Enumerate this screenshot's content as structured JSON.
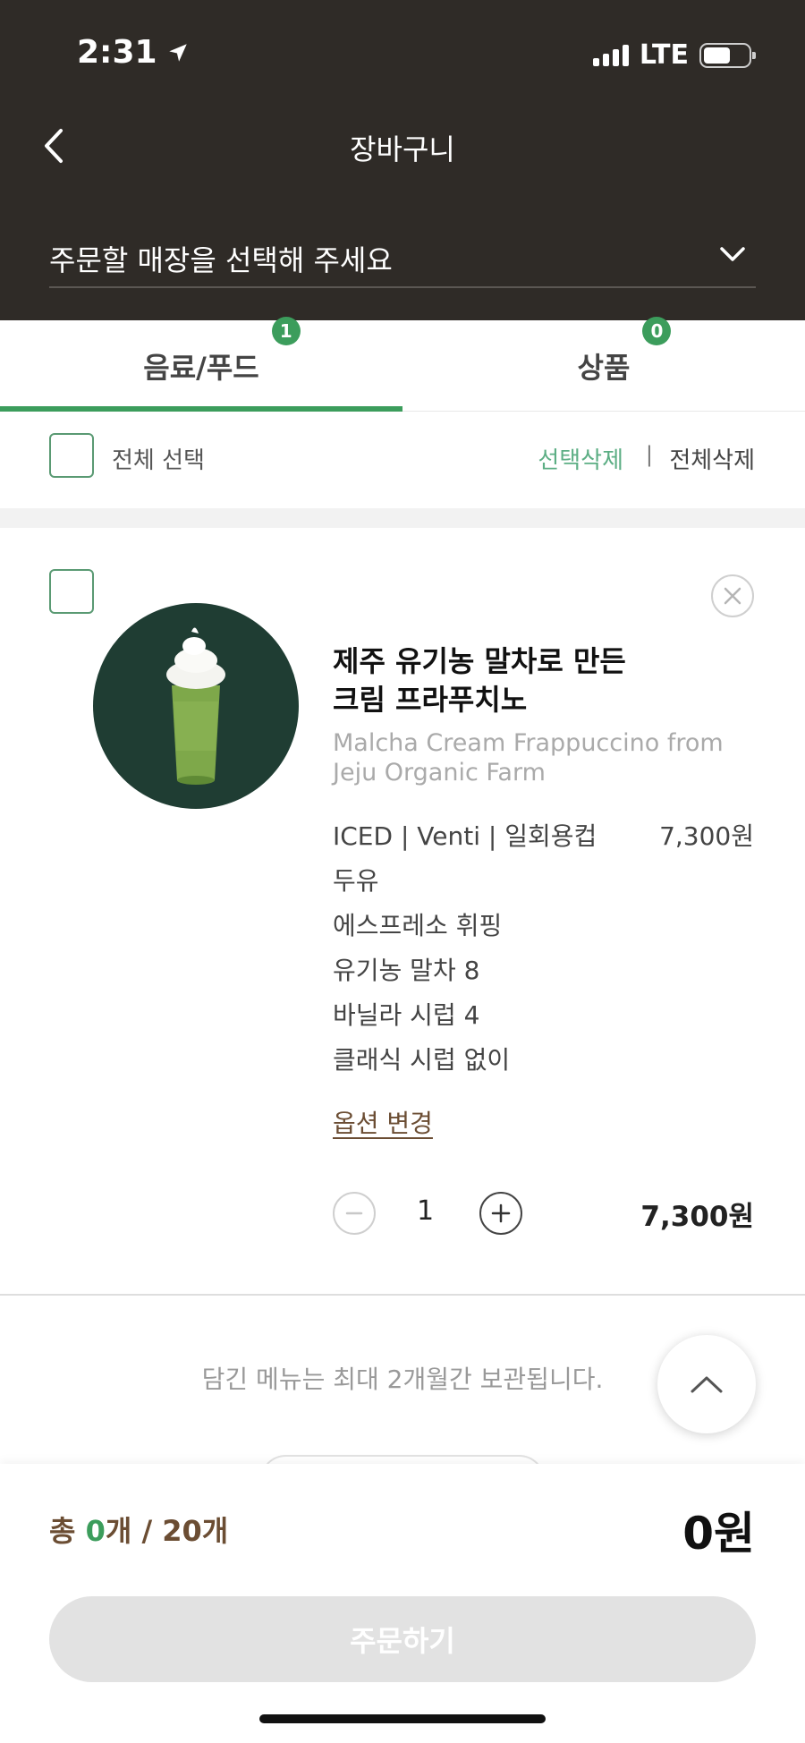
{
  "status_bar": {
    "time": "2:31",
    "network": "LTE"
  },
  "header": {
    "title": "장바구니",
    "store_placeholder": "주문할 매장을 선택해 주세요"
  },
  "tabs": [
    {
      "label": "음료/푸드",
      "badge": "1",
      "active": true
    },
    {
      "label": "상품",
      "badge": "0",
      "active": false
    }
  ],
  "select_bar": {
    "select_all_label": "전체 선택",
    "delete_selected": "선택삭제",
    "separator": "|",
    "delete_all": "전체삭제"
  },
  "cart_item": {
    "name_ko_line1": "제주 유기농 말차로 만든",
    "name_ko_line2": "크림 프라푸치노",
    "name_en": "Malcha Cream Frappuccino from Jeju Organic Farm",
    "base_option": "ICED | Venti | 일회용컵",
    "base_price": "7,300원",
    "options": [
      "두유",
      "에스프레소 휘핑",
      "유기농 말차 8",
      "바닐라 시럽 4",
      "클래식 시럽 없이"
    ],
    "change_option_label": "옵션 변경",
    "quantity": "1",
    "total": "7,300원"
  },
  "notice": "담긴 메뉴는 최대 2개월간 보관됩니다.",
  "footer": {
    "summary_prefix": "총 ",
    "selected_count": "0",
    "summary_suffix": "개 / 20개",
    "total_price": "0원",
    "order_button": "주문하기"
  },
  "colors": {
    "header_bg": "#2f2b27",
    "accent_green": "#3c9d5c",
    "brown": "#6b4d33",
    "disabled_btn": "#e2e2e2"
  }
}
